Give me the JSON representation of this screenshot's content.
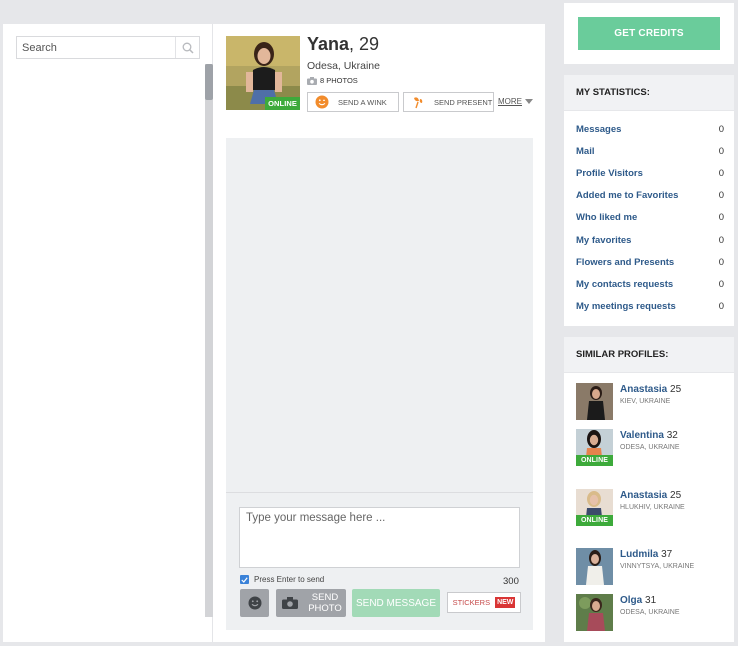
{
  "search": {
    "placeholder": "Search"
  },
  "profile": {
    "name": "Yana",
    "age": "29",
    "location": "Odesa, Ukraine",
    "photos_label": "8 PHOTOS",
    "online_label": "ONLINE",
    "wink_label": "SEND A WINK",
    "present_label": "SEND PRESENT",
    "more_label": "MORE"
  },
  "composer": {
    "placeholder": "Type your message here ...",
    "enter_to_send_label": "Press Enter to send",
    "char_count": "300",
    "send_photo_label": "SEND PHOTO",
    "send_message_label": "SEND MESSAGE",
    "stickers_label": "STICKERS",
    "stickers_badge": "NEW"
  },
  "credits": {
    "button_label": "GET CREDITS"
  },
  "statistics": {
    "title": "MY STATISTICS:",
    "items": [
      {
        "label": "Messages",
        "value": "0"
      },
      {
        "label": "Mail",
        "value": "0"
      },
      {
        "label": "Profile Visitors",
        "value": "0"
      },
      {
        "label": "Added me to Favorites",
        "value": "0"
      },
      {
        "label": "Who liked me",
        "value": "0"
      },
      {
        "label": "My favorites",
        "value": "0"
      },
      {
        "label": "Flowers and Presents",
        "value": "0"
      },
      {
        "label": "My contacts requests",
        "value": "0"
      },
      {
        "label": "My meetings requests",
        "value": "0"
      }
    ]
  },
  "similar": {
    "title": "SIMILAR PROFILES:",
    "online_label": "ONLINE",
    "items": [
      {
        "name": "Anastasia",
        "age": "25",
        "location": "KIEV, UKRAINE"
      },
      {
        "name": "Valentina",
        "age": "32",
        "location": "ODESA, UKRAINE"
      },
      {
        "name": "Anastasia",
        "age": "25",
        "location": "HLUKHIV, UKRAINE"
      },
      {
        "name": "Ludmila",
        "age": "37",
        "location": "VINNYTSYA, UKRAINE"
      },
      {
        "name": "Olga",
        "age": "31",
        "location": "ODESA, UKRAINE"
      }
    ]
  },
  "colors": {
    "link_blue": "#2e5a8a",
    "online_green": "#3daa3b",
    "credits_green": "#6acc9b",
    "send_message_green": "#a2dab7",
    "new_badge_red": "#d93535",
    "checkbox_blue": "#3a82d8"
  },
  "icons": {
    "search": "search-icon",
    "camera_small": "camera-icon",
    "wink": "wink-smiley-icon",
    "present": "flower-present-icon",
    "more": "chevron-down-icon",
    "emoji": "smiley-icon",
    "photo": "camera-icon",
    "checkbox": "checkmark-icon"
  }
}
